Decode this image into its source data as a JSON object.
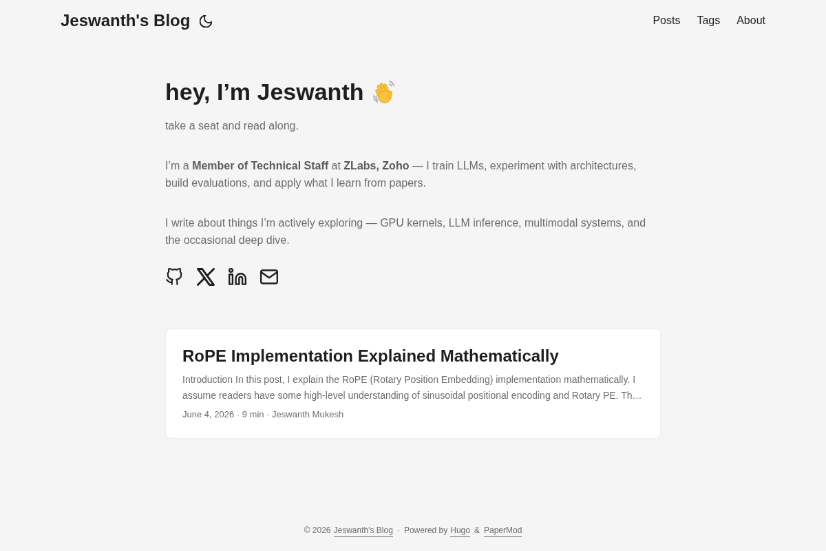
{
  "header": {
    "logo": "Jeswanth's Blog",
    "theme_toggle": {
      "kind": "moon"
    },
    "menu": [
      "Posts",
      "Tags",
      "About"
    ]
  },
  "intro": {
    "title": "hey, I’m Jeswanth",
    "emoji": {
      "kind": "wave"
    },
    "paragraphs": [
      "take a seat and read along.",
      "I’m a **Member of Technical Staff** at **ZLabs, Zoho** — I train LLMs, experiment with architectures, build evaluations, and apply what I learn from papers.",
      "I write about things I’m actively exploring — GPU kernels, LLM inference, multimodal systems, and the occasional deep dive."
    ],
    "social_links": [
      {
        "kind": "github"
      },
      {
        "kind": "x"
      },
      {
        "kind": "linkedin"
      },
      {
        "kind": "email"
      }
    ]
  },
  "posts": [
    {
      "title": "RoPE Implementation Explained Mathematically",
      "summary": "Introduction In this post, I explain the RoPE (Rotary Position Embedding) implementation mathematically. I assume readers have some high-level understanding of sinusoidal positional encoding and Rotary PE. Th…",
      "meta": "June 4, 2026 · 9 min · Jeswanth Mukesh"
    }
  ],
  "footer": {
    "parts": [
      {
        "kind": "text",
        "text": "© 2026"
      },
      {
        "kind": "link",
        "text": "Jeswanth's Blog"
      },
      {
        "kind": "text",
        "text": "·"
      },
      {
        "kind": "text",
        "text": "Powered by"
      },
      {
        "kind": "link",
        "text": "Hugo"
      },
      {
        "kind": "text",
        "text": "&"
      },
      {
        "kind": "link",
        "text": "PaperMod"
      }
    ]
  }
}
